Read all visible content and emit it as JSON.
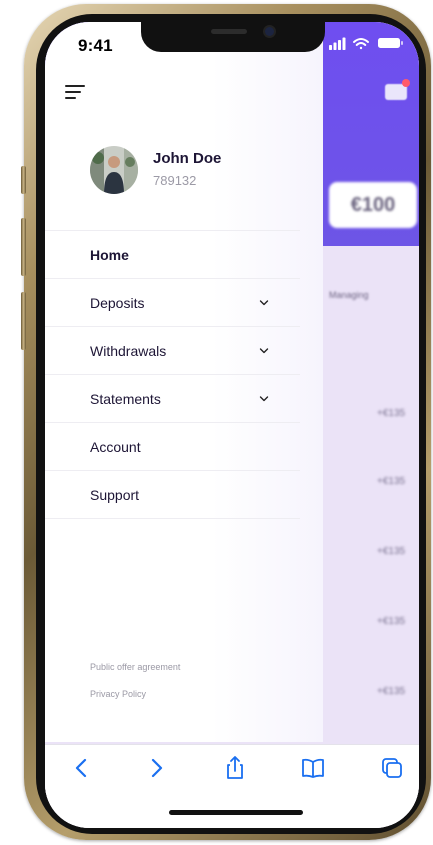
{
  "status_bar": {
    "time": "9:41"
  },
  "user": {
    "name": "John Doe",
    "id": "789132"
  },
  "menu": {
    "items": [
      {
        "label": "Home",
        "active": true,
        "expandable": false
      },
      {
        "label": "Deposits",
        "active": false,
        "expandable": true
      },
      {
        "label": "Withdrawals",
        "active": false,
        "expandable": true
      },
      {
        "label": "Statements",
        "active": false,
        "expandable": true
      },
      {
        "label": "Account",
        "active": false,
        "expandable": false
      },
      {
        "label": "Support",
        "active": false,
        "expandable": false
      }
    ]
  },
  "legal": {
    "offer": "Public offer agreement",
    "privacy": "Privacy Policy"
  },
  "background": {
    "amount": "€100",
    "label": "Managing",
    "values": [
      "+€135",
      "+€135",
      "+€135",
      "+€135",
      "+€135"
    ]
  },
  "toolbar": {
    "icons": [
      "back-icon",
      "forward-icon",
      "share-icon",
      "bookmarks-icon",
      "tabs-icon"
    ]
  },
  "colors": {
    "accent": "#6c4ef0",
    "toolbar_icon": "#1a6ff0",
    "text": "#1d1535",
    "muted": "#9c9aa6"
  }
}
